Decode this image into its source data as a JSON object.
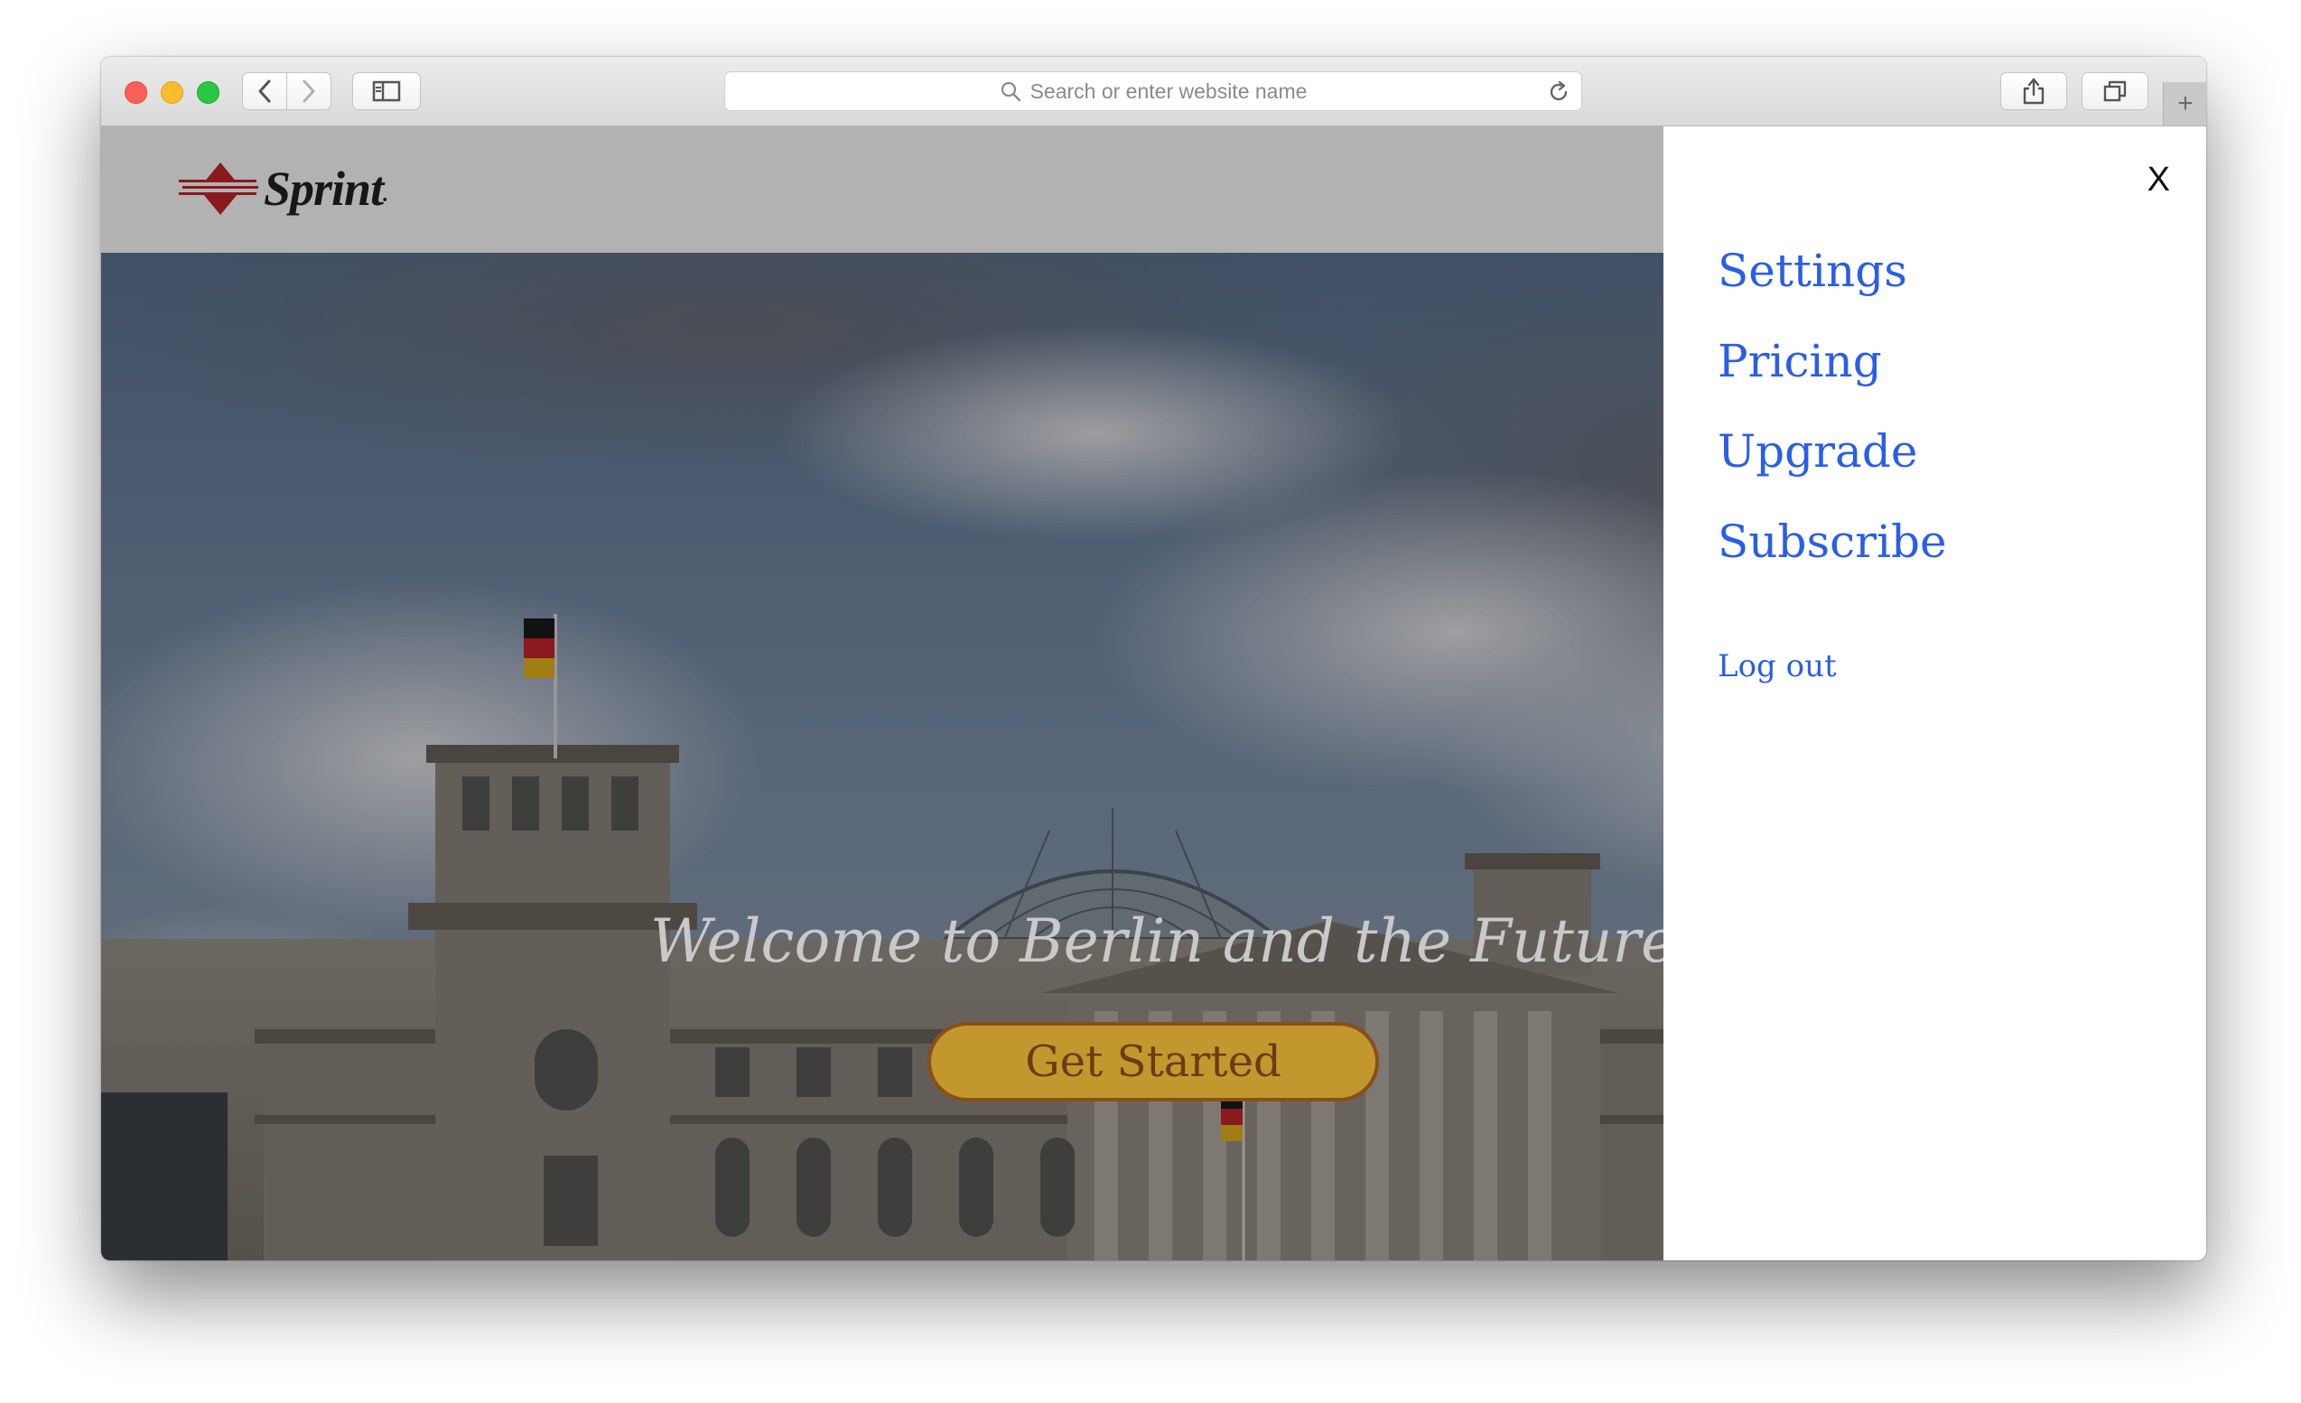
{
  "browser": {
    "address_placeholder": "Search or enter website name",
    "icons": [
      "chevron-left-icon",
      "chevron-right-icon",
      "sidebar-icon",
      "search-icon",
      "reload-icon",
      "share-icon",
      "tabs-icon",
      "plus-icon"
    ],
    "new_tab_symbol": "+"
  },
  "site": {
    "logo_text": "Sprint",
    "logo_dot": ".",
    "colors": {
      "logo_red": "#c4252c",
      "cta_fill": "#c2982e",
      "cta_border": "#8a4f16",
      "menu_link": "#2a5ee8"
    }
  },
  "hero": {
    "title": "Welcome to Berlin and the Future.",
    "cta_label": "Get Started"
  },
  "drawer": {
    "close_label": "X",
    "items": [
      {
        "label": "Settings"
      },
      {
        "label": "Pricing"
      },
      {
        "label": "Upgrade"
      },
      {
        "label": "Subscribe"
      }
    ],
    "logout_label": "Log out"
  }
}
